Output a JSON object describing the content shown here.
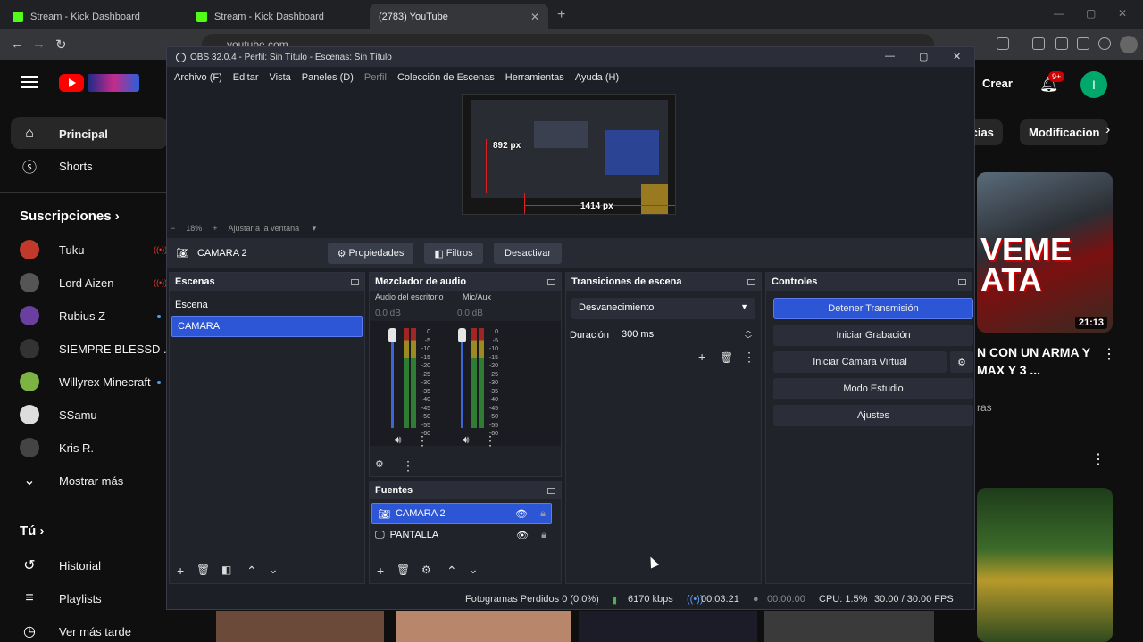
{
  "browser": {
    "tabs": [
      {
        "title": "Stream - Kick Dashboard",
        "icon": "kick-icon"
      },
      {
        "title": "Stream - Kick Dashboard",
        "icon": "kick-icon"
      },
      {
        "title": "(2783) YouTube",
        "icon": "youtube-icon"
      }
    ],
    "url": "youtube.com"
  },
  "youtube": {
    "nav": [
      {
        "label": "Principal",
        "icon": "home-icon"
      },
      {
        "label": "Shorts",
        "icon": "shorts-icon"
      }
    ],
    "subscriptions_title": "Suscripciones",
    "subscriptions": [
      {
        "name": "Tuku",
        "color": "#c0392b"
      },
      {
        "name": "Lord Aizen",
        "color": "#555555"
      },
      {
        "name": "Rubius Z",
        "color": "#6a3fa0"
      },
      {
        "name": "SIEMPRE BLESSD ...",
        "color": "#333333"
      },
      {
        "name": "Willyrex Minecraft",
        "color": "#7cb342"
      },
      {
        "name": "SSamu",
        "color": "#dddddd"
      },
      {
        "name": "Kris R.",
        "color": "#444444"
      }
    ],
    "show_more": "Mostrar más",
    "you_title": "Tú",
    "you_items": [
      {
        "label": "Historial",
        "icon": "history-icon"
      },
      {
        "label": "Playlists",
        "icon": "playlists-icon"
      },
      {
        "label": "Ver más tarde",
        "icon": "clock-icon"
      }
    ],
    "create_label": "Crear",
    "notif_badge": "9+",
    "user_initial": "I",
    "chips": [
      "icias",
      "Modificacion"
    ],
    "video1": {
      "overlay": "VEME\nATA",
      "duration": "21:13",
      "title": "N CON UN ARMA Y MAX Y 3 ...",
      "meta": "ras"
    }
  },
  "obs": {
    "title": "OBS 32.0.4 - Perfil: Sin Título - Escenas: Sin Título",
    "menu": [
      "Archivo (F)",
      "Editar",
      "Vista",
      "Paneles (D)",
      "Perfil",
      "Colección de Escenas",
      "Herramientas",
      "Ayuda (H)"
    ],
    "preview": {
      "height_label": "892 px",
      "width_label": "1414 px"
    },
    "zoom": {
      "minus": "−",
      "value": "18%",
      "plus": "+",
      "fit": "Ajustar a la ventana"
    },
    "source_bar": {
      "name": "CAMARA 2",
      "props": "Propiedades",
      "filters": "Filtros",
      "deactivate": "Desactivar"
    },
    "scenes": {
      "title": "Escenas",
      "items": [
        "Escena",
        "CAMARA"
      ],
      "selected": 1
    },
    "mixer": {
      "title": "Mezclador de audio",
      "channels": [
        {
          "name": "Audio del escritorio",
          "db": "0.0 dB"
        },
        {
          "name": "Mic/Aux",
          "db": "0.0 dB"
        }
      ],
      "scale": [
        "0",
        "-5",
        "-10",
        "-15",
        "-20",
        "-25",
        "-30",
        "-35",
        "-40",
        "-45",
        "-50",
        "-55",
        "-60"
      ]
    },
    "sources": {
      "title": "Fuentes",
      "items": [
        "CAMARA 2",
        "PANTALLA"
      ]
    },
    "transitions": {
      "title": "Transiciones de escena",
      "type": "Desvanecimiento",
      "duration_label": "Duración",
      "duration": "300 ms"
    },
    "controls": {
      "title": "Controles",
      "buttons": [
        "Detener Transmisión",
        "Iniciar Grabación",
        "Iniciar Cámara Virtual",
        "Modo Estudio",
        "Ajustes"
      ]
    },
    "status": {
      "dropped": "Fotogramas Perdidos 0 (0.0%)",
      "bitrate": "6170 kbps",
      "stream_time": "00:03:21",
      "rec_time": "00:00:00",
      "cpu": "CPU: 1.5%",
      "fps": "30.00 / 30.00 FPS"
    }
  }
}
